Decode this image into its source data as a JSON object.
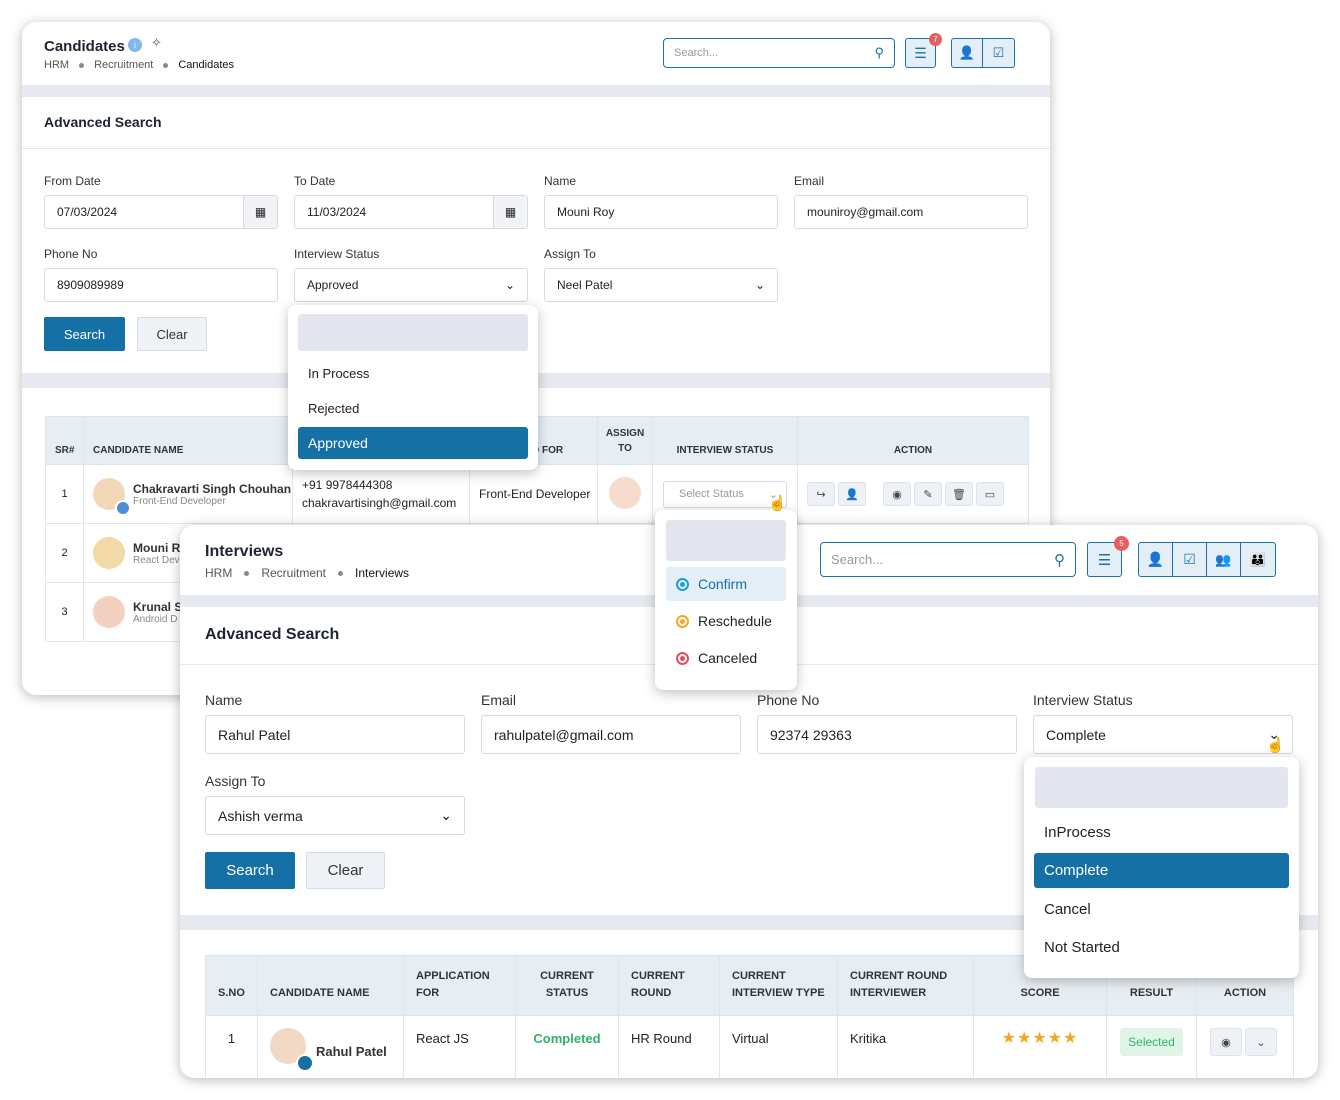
{
  "candidates": {
    "title": "Candidates",
    "breadcrumb": [
      "HRM",
      "Recruitment",
      "Candidates"
    ],
    "search_placeholder": "Search...",
    "filter_badge": "7",
    "advanced_search": {
      "title": "Advanced Search",
      "from_date": {
        "label": "From Date",
        "value": "07/03/2024"
      },
      "to_date": {
        "label": "To Date",
        "value": "11/03/2024"
      },
      "name": {
        "label": "Name",
        "value": "Mouni Roy"
      },
      "email": {
        "label": "Email",
        "value": "mouniroy@gmail.com"
      },
      "phone": {
        "label": "Phone No",
        "value": "8909089989"
      },
      "interview_status": {
        "label": "Interview Status",
        "value": "Approved",
        "options": [
          "In Process",
          "Rejected",
          "Approved"
        ]
      },
      "assign_to": {
        "label": "Assign To",
        "value": "Neel Patel"
      },
      "search_label": "Search",
      "clear_label": "Clear"
    },
    "table": {
      "headers": [
        "SR#",
        "CANDIDATE NAME",
        "",
        "D FOR",
        "ASSIGN TO",
        "INTERVIEW STATUS",
        "ACTION"
      ],
      "rows": [
        {
          "sr": "1",
          "name": "Chakravarti Singh Chouhan",
          "role": "Front-End Developer",
          "phone": "+91 9978444308",
          "email": "chakravartisingh@gmail.com",
          "applied_for": "Front-End Developer",
          "status": "Select Status"
        },
        {
          "sr": "2",
          "name": "Mouni R",
          "role": "React Dev"
        },
        {
          "sr": "3",
          "name": "Krunal S",
          "role": "Android D"
        }
      ],
      "status_options": [
        "Confirm",
        "Reschedule",
        "Canceled"
      ],
      "status_colors": [
        "#1a9fd6",
        "#f5a623",
        "#e84a5f"
      ]
    }
  },
  "interviews": {
    "title": "Interviews",
    "breadcrumb": [
      "HRM",
      "Recruitment",
      "Interviews"
    ],
    "search_placeholder": "Search...",
    "filter_badge": "5",
    "advanced_search": {
      "title": "Advanced Search",
      "name": {
        "label": "Name",
        "value": "Rahul Patel"
      },
      "email": {
        "label": "Email",
        "value": "rahulpatel@gmail.com"
      },
      "phone": {
        "label": "Phone No",
        "value": "92374 29363"
      },
      "interview_status": {
        "label": "Interview Status",
        "value": "Complete",
        "options": [
          "InProcess",
          "Complete",
          "Cancel",
          "Not Started"
        ]
      },
      "assign_to": {
        "label": "Assign To",
        "value": "Ashish verma"
      },
      "search_label": "Search",
      "clear_label": "Clear"
    },
    "table": {
      "headers": [
        "S.NO",
        "CANDIDATE NAME",
        "APPLICATION FOR",
        "CURRENT STATUS",
        "CURRENT ROUND",
        "CURRENT INTERVIEW TYPE",
        "CURRENT ROUND INTERVIEWER",
        "SCORE",
        "RESULT",
        "ACTION"
      ],
      "rows": [
        {
          "sno": "1",
          "name": "Rahul Patel",
          "application_for": "React JS",
          "status": "Completed",
          "round": "HR Round",
          "type": "Virtual",
          "interviewer": "Kritika",
          "score": 5,
          "result": "Selected"
        }
      ]
    }
  },
  "colors": {
    "primary": "#1570a6",
    "success": "#2fb36b",
    "star": "#f5a623",
    "badge": "#e85d5d"
  }
}
